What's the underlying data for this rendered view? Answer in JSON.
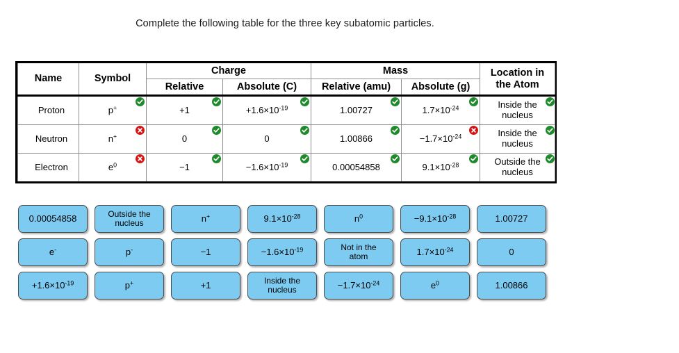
{
  "prompt": "Complete the following table for the three key subatomic particles.",
  "colors": {
    "tile_fill": "#7ecbf2",
    "tile_border": "#4a4a4a",
    "badge_correct": "#1d8a2b",
    "badge_incorrect": "#d31616",
    "table_border": "#000000"
  },
  "table": {
    "headers": {
      "name": "Name",
      "symbol": "Symbol",
      "charge_group": "Charge",
      "charge_relative": "Relative",
      "charge_absolute": "Absolute (C)",
      "mass_group": "Mass",
      "mass_relative": "Relative (amu)",
      "mass_absolute": "Absolute (g)",
      "location_line1": "Location in",
      "location_line2": "the Atom"
    },
    "rows": [
      {
        "name": "Proton",
        "symbol": {
          "base": "p",
          "sup": "+",
          "status": "correct"
        },
        "charge_relative": {
          "text": "+1",
          "status": "correct"
        },
        "charge_absolute": {
          "base": "+1.6×10",
          "sup": "-19",
          "status": "correct"
        },
        "mass_relative": {
          "text": "1.00727",
          "status": "correct"
        },
        "mass_absolute": {
          "base": "1.7×10",
          "sup": "-24",
          "status": "correct"
        },
        "location": {
          "line1": "Inside the",
          "line2": "nucleus",
          "status": "correct"
        }
      },
      {
        "name": "Neutron",
        "symbol": {
          "base": "n",
          "sup": "+",
          "status": "incorrect"
        },
        "charge_relative": {
          "text": "0",
          "status": "correct"
        },
        "charge_absolute": {
          "base": "0",
          "sup": "",
          "status": "correct"
        },
        "mass_relative": {
          "text": "1.00866",
          "status": "correct"
        },
        "mass_absolute": {
          "base": "−1.7×10",
          "sup": "-24",
          "status": "incorrect"
        },
        "location": {
          "line1": "Inside the",
          "line2": "nucleus",
          "status": "correct"
        }
      },
      {
        "name": "Electron",
        "symbol": {
          "base": "e",
          "sup": "0",
          "status": "incorrect"
        },
        "charge_relative": {
          "text": "−1",
          "status": "correct"
        },
        "charge_absolute": {
          "base": "−1.6×10",
          "sup": "-19",
          "status": "correct"
        },
        "mass_relative": {
          "text": "0.00054858",
          "status": "correct"
        },
        "mass_absolute": {
          "base": "9.1×10",
          "sup": "-28",
          "status": "correct"
        },
        "location": {
          "line1": "Outside the",
          "line2": "nucleus",
          "status": "correct"
        }
      }
    ]
  },
  "tiles": [
    [
      {
        "base": "0.00054858",
        "sup": "",
        "two_line": false
      },
      {
        "base": "Outside the\nnucleus",
        "sup": "",
        "two_line": true
      },
      {
        "base": "n",
        "sup": "+",
        "two_line": false
      },
      {
        "base": "9.1×10",
        "sup": "-28",
        "two_line": false
      },
      {
        "base": "n",
        "sup": "0",
        "two_line": false
      },
      {
        "base": "−9.1×10",
        "sup": "-28",
        "two_line": false
      },
      {
        "base": "1.00727",
        "sup": "",
        "two_line": false
      }
    ],
    [
      {
        "base": "e",
        "sup": "-",
        "two_line": false
      },
      {
        "base": "p",
        "sup": "-",
        "two_line": false
      },
      {
        "base": "−1",
        "sup": "",
        "two_line": false
      },
      {
        "base": "−1.6×10",
        "sup": "-19",
        "two_line": false
      },
      {
        "base": "Not in the\natom",
        "sup": "",
        "two_line": true
      },
      {
        "base": "1.7×10",
        "sup": "-24",
        "two_line": false
      },
      {
        "base": "0",
        "sup": "",
        "two_line": false
      }
    ],
    [
      {
        "base": "+1.6×10",
        "sup": "-19",
        "two_line": false
      },
      {
        "base": "p",
        "sup": "+",
        "two_line": false
      },
      {
        "base": "+1",
        "sup": "",
        "two_line": false
      },
      {
        "base": "Inside the\nnucleus",
        "sup": "",
        "two_line": true
      },
      {
        "base": "−1.7×10",
        "sup": "-24",
        "two_line": false
      },
      {
        "base": "e",
        "sup": "0",
        "two_line": false
      },
      {
        "base": "1.00866",
        "sup": "",
        "two_line": false
      }
    ]
  ]
}
